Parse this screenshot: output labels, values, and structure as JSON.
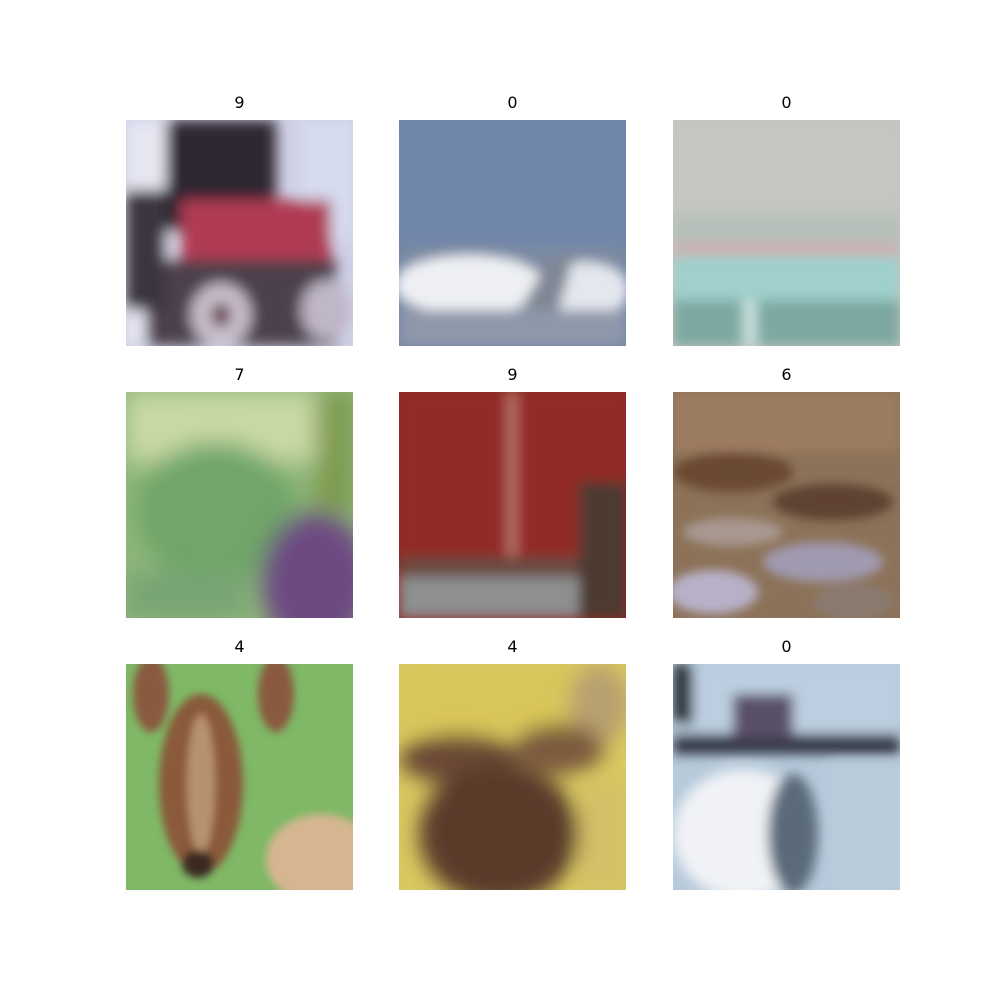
{
  "grid": {
    "labels": [
      "9",
      "0",
      "0",
      "7",
      "9",
      "6",
      "4",
      "4",
      "0"
    ]
  }
}
